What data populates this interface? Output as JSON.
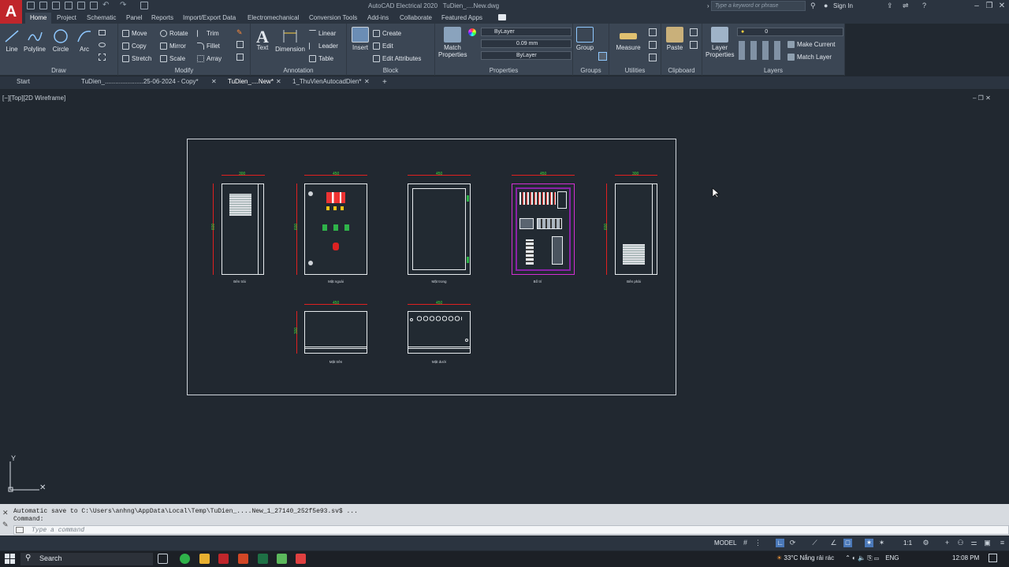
{
  "app": {
    "title": "AutoCAD Electrical 2020",
    "document": "TuDien_....New.dwg",
    "search_placeholder": "Type a keyword or phrase",
    "sign_in": "Sign In"
  },
  "ribbon_tabs": [
    "Home",
    "Project",
    "Schematic",
    "Panel",
    "Reports",
    "Import/Export Data",
    "Electromechanical",
    "Conversion Tools",
    "Add-ins",
    "Collaborate",
    "Featured Apps"
  ],
  "draw": {
    "label": "Draw",
    "line": "Line",
    "polyline": "Polyline",
    "circle": "Circle",
    "arc": "Arc"
  },
  "modify": {
    "label": "Modify",
    "move": "Move",
    "rotate": "Rotate",
    "trim": "Trim",
    "copy": "Copy",
    "mirror": "Mirror",
    "fillet": "Fillet",
    "stretch": "Stretch",
    "scale": "Scale",
    "array": "Array"
  },
  "annotation": {
    "label": "Annotation",
    "text": "Text",
    "dimension": "Dimension",
    "linear": "Linear",
    "leader": "Leader",
    "table": "Table"
  },
  "block": {
    "label": "Block",
    "insert": "Insert",
    "create": "Create",
    "edit": "Edit",
    "edit_attributes": "Edit Attributes"
  },
  "properties": {
    "label": "Properties",
    "match": "Match",
    "match2": "Properties",
    "color": "ByLayer",
    "lineweight": "0.09 mm",
    "linetype": "ByLayer"
  },
  "groups": {
    "label": "Groups",
    "group": "Group"
  },
  "utilities": {
    "label": "Utilities",
    "measure": "Measure"
  },
  "clipboard": {
    "label": "Clipboard",
    "paste": "Paste"
  },
  "layers": {
    "label": "Layers",
    "layer_props": "Layer",
    "layer_props2": "Properties",
    "current_layer": "0",
    "make_current": "Make Current",
    "match_layer": "Match Layer"
  },
  "doc_tabs": [
    "Start",
    "TuDien_......................25-06-2024 - Copy*",
    "TuDien_....New*",
    "1_ThuVienAutocadDien*"
  ],
  "viewport": {
    "label": "[−][Top][2D Wireframe]"
  },
  "drawing": {
    "views": [
      {
        "caption": "Bên trái",
        "width_dim": "300",
        "height_dim": "600"
      },
      {
        "caption": "Mặt ngoài",
        "width_dim": "450",
        "height_dim": "600"
      },
      {
        "caption": "Mặt trong",
        "width_dim": "450",
        "height_dim": ""
      },
      {
        "caption": "Bố trí",
        "width_dim": "450",
        "height_dim": ""
      },
      {
        "caption": "Bên phải",
        "width_dim": "300",
        "height_dim": "600"
      },
      {
        "caption": "Mặt trên",
        "width_dim": "450",
        "height_dim": "300"
      },
      {
        "caption": "Mặt dưới",
        "width_dim": "450",
        "height_dim": ""
      }
    ]
  },
  "command": {
    "line1": "Automatic save to C:\\Users\\anhng\\AppData\\Local\\Temp\\TuDien_....New_1_27140_252f5e93.sv$ ...",
    "line2": "Command:",
    "placeholder": "Type a command"
  },
  "status": {
    "model": "MODEL",
    "scale": "1:1"
  },
  "taskbar": {
    "search": "Search",
    "weather": "33°C  Nắng rải rác",
    "lang": "ENG",
    "time": "12:08 PM"
  },
  "colors": {
    "accent": "#c0262b",
    "ribbon": "#3b4654",
    "canvas": "#212830",
    "dim": "#e02020",
    "dimtext": "#3adf3a"
  }
}
